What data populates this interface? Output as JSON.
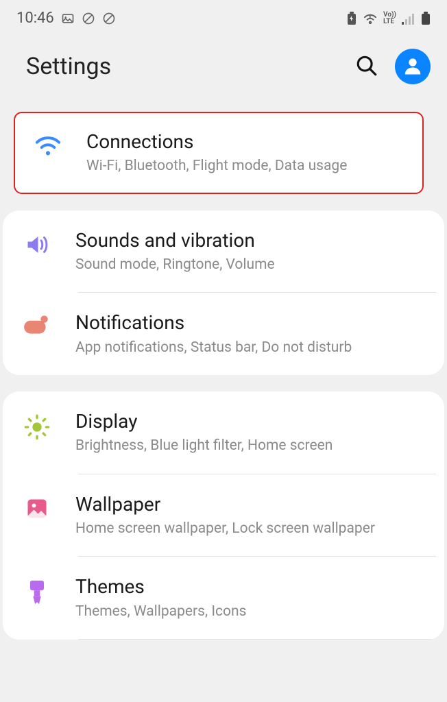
{
  "status": {
    "time": "10:46",
    "lte_label_top": "Vo))",
    "lte_label_bottom": "LTE"
  },
  "header": {
    "title": "Settings"
  },
  "groups": [
    {
      "highlighted": true,
      "items": [
        {
          "icon": "wifi",
          "title": "Connections",
          "sub": "Wi-Fi, Bluetooth, Flight mode, Data usage"
        }
      ]
    },
    {
      "items": [
        {
          "icon": "sound",
          "title": "Sounds and vibration",
          "sub": "Sound mode, Ringtone, Volume"
        },
        {
          "icon": "notif",
          "title": "Notifications",
          "sub": "App notifications, Status bar, Do not disturb"
        }
      ]
    },
    {
      "items": [
        {
          "icon": "display",
          "title": "Display",
          "sub": "Brightness, Blue light filter, Home screen"
        },
        {
          "icon": "wallpaper",
          "title": "Wallpaper",
          "sub": "Home screen wallpaper, Lock screen wallpaper"
        },
        {
          "icon": "themes",
          "title": "Themes",
          "sub": "Themes, Wallpapers, Icons"
        }
      ]
    }
  ]
}
